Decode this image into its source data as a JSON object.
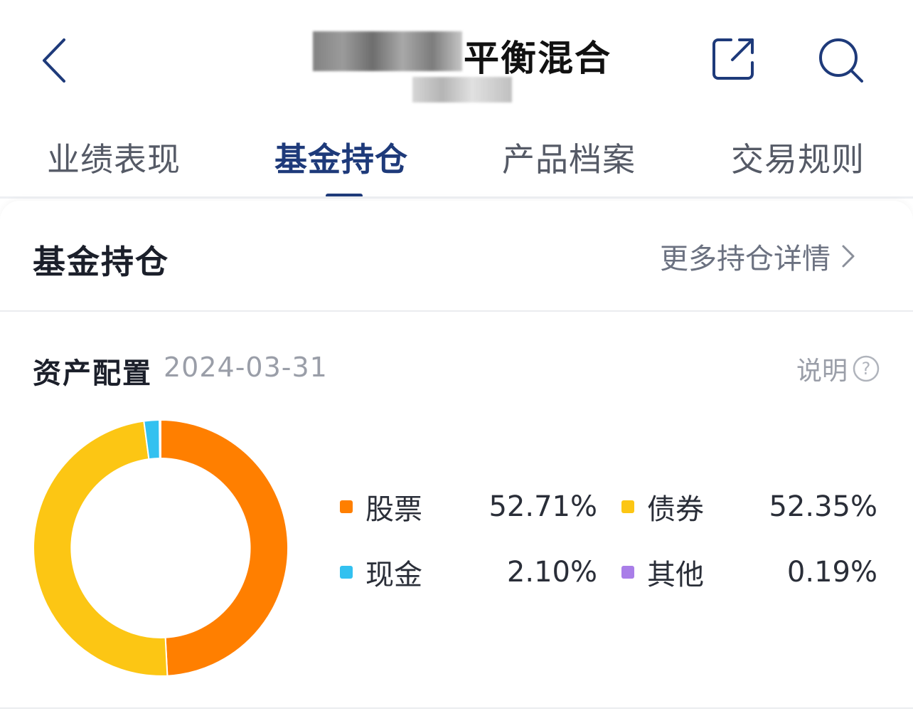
{
  "header": {
    "title_visible": "平衡混合",
    "colors": {
      "title": "#111111",
      "icon": "#1e3a7a"
    }
  },
  "tabs": [
    {
      "label": "业绩表现",
      "active": false
    },
    {
      "label": "基金持仓",
      "active": true
    },
    {
      "label": "产品档案",
      "active": false
    },
    {
      "label": "交易规则",
      "active": false
    }
  ],
  "holdings": {
    "section_title": "基金持仓",
    "more_link": "更多持仓详情",
    "allocation_title": "资产配置",
    "date": "2024-03-31",
    "explain_label": "说明",
    "allocation": [
      {
        "name": "股票",
        "value": "52.71%",
        "color": "#ff7f00"
      },
      {
        "name": "债券",
        "value": "52.35%",
        "color": "#fcc614"
      },
      {
        "name": "现金",
        "value": "2.10%",
        "color": "#33c1f0"
      },
      {
        "name": "其他",
        "value": "0.19%",
        "color": "#a97ee8"
      }
    ]
  },
  "icons": {
    "back": "chevron-left-icon",
    "share": "share-icon",
    "search": "search-icon",
    "more": "chevron-right-icon",
    "help": "question-circle-icon"
  }
}
